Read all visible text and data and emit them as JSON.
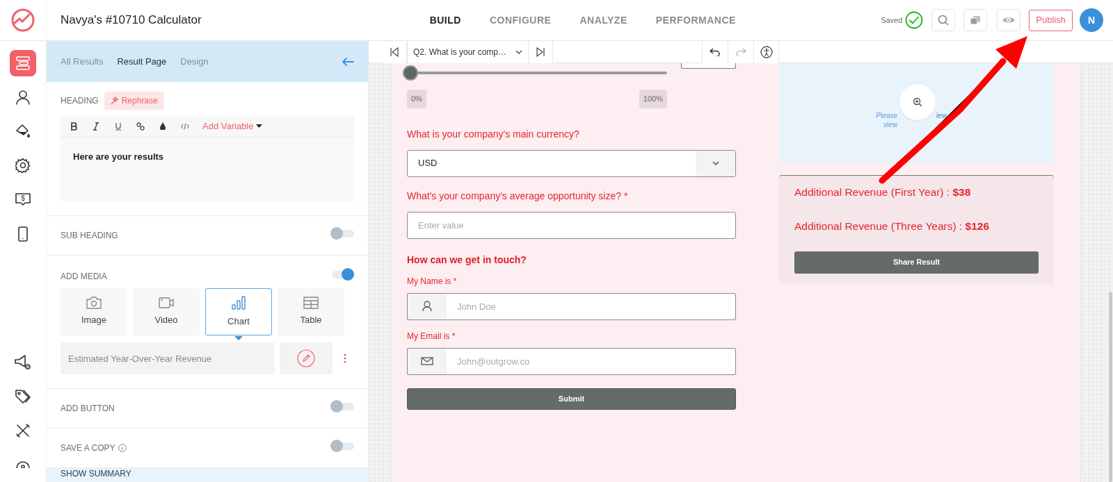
{
  "app": {
    "title": "Navya's #10710 Calculator",
    "save_status": "Saved",
    "publish": "Publish",
    "avatar": "N"
  },
  "nav_tabs": [
    {
      "label": "BUILD",
      "selected": true
    },
    {
      "label": "CONFIGURE",
      "selected": false
    },
    {
      "label": "ANALYZE",
      "selected": false
    },
    {
      "label": "PERFORMANCE",
      "selected": false
    }
  ],
  "sidebar_top": [
    {
      "kind": "results",
      "selected": true
    },
    {
      "kind": "person",
      "selected": false
    },
    {
      "kind": "paint",
      "selected": false
    },
    {
      "kind": "gear",
      "selected": false
    },
    {
      "kind": "money",
      "selected": false,
      "glyph": "$"
    },
    {
      "kind": "phone",
      "selected": false
    }
  ],
  "sidebar_bottom": [
    {
      "kind": "megaphone",
      "selected": false
    },
    {
      "kind": "tag",
      "selected": false
    },
    {
      "kind": "tools",
      "selected": false
    },
    {
      "kind": "pin",
      "selected": false
    }
  ],
  "panel": {
    "tabs": [
      {
        "label": "All Results",
        "selected": false
      },
      {
        "label": "Result Page",
        "selected": true
      },
      {
        "label": "Design",
        "selected": false
      }
    ],
    "heading": {
      "label": "HEADING",
      "rephrase": "Rephrase",
      "add_variable": "Add Variable",
      "text": "Here are your results"
    },
    "sections": [
      {
        "kind": "toggle",
        "label": "SUB HEADING",
        "on": false
      },
      {
        "kind": "media",
        "label": "ADD MEDIA",
        "on": true,
        "media_types": [
          {
            "kind": "image",
            "label": "Image",
            "selected": false
          },
          {
            "kind": "video",
            "label": "Video",
            "selected": false
          },
          {
            "kind": "chart",
            "label": "Chart",
            "selected": true
          },
          {
            "kind": "table",
            "label": "Table",
            "selected": false
          }
        ],
        "chart_title": "Estimated Year-Over-Year Revenue"
      },
      {
        "kind": "toggle",
        "label": "ADD BUTTON",
        "on": false
      },
      {
        "kind": "toggle",
        "label": "SAVE A COPY",
        "on": false,
        "info": true
      }
    ],
    "show_summary": "SHOW SUMMARY"
  },
  "toolbar": {
    "question": "Q2. What is your comp…"
  },
  "form": {
    "slider": {
      "level": 0,
      "min_label": "0%",
      "max_label": "100%"
    },
    "currency": {
      "label": "What is your company's main currency?",
      "value": "USD"
    },
    "opportunity": {
      "label": "What's your company's average opportunity size? *",
      "placeholder": "Enter value"
    },
    "contact_heading": "How can we get in touch?",
    "fields": [
      {
        "kind": "person",
        "label": "My Name is *",
        "placeholder": "John Doe"
      },
      {
        "kind": "email",
        "label": "My Email is *",
        "placeholder": "John@outgrow.co"
      }
    ],
    "submit": "Submit"
  },
  "results": {
    "chart_preview": {
      "left_text": [
        "Please",
        "view"
      ],
      "right_text": [
        "iew"
      ]
    },
    "lines": [
      "Additional Revenue (First Year) : **$38**",
      "Additional Revenue (Three Years) : **$126**"
    ],
    "share": "Share Result"
  }
}
